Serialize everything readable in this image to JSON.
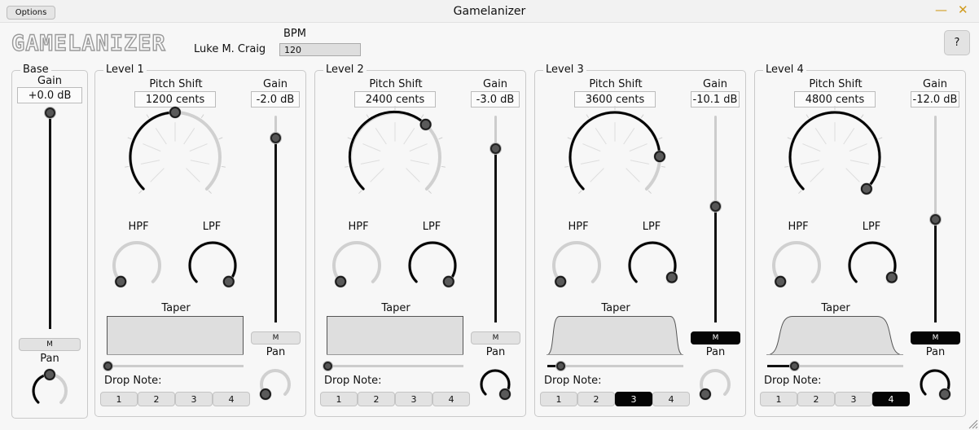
{
  "window": {
    "title": "Gamelanizer",
    "options_label": "Options",
    "minimize_glyph": "—",
    "close_glyph": "✕"
  },
  "header": {
    "logo": "GAMELANIZER",
    "author": "Luke M. Craig",
    "bpm_label": "BPM",
    "bpm_value": "120",
    "help_label": "?"
  },
  "base": {
    "title": "Base",
    "gain_label": "Gain",
    "gain_value": "+0.0 dB",
    "gain_level": 1.0,
    "mute_label": "M",
    "pan_label": "Pan",
    "pan_value": 0.5
  },
  "levels": [
    {
      "title": "Level 1",
      "pitch_label": "Pitch Shift",
      "pitch_value": "1200 cents",
      "pitch_knob": 0.5,
      "gain_label": "Gain",
      "gain_value": "-2.0 dB",
      "gain_level": 0.89,
      "hpf_label": "HPF",
      "hpf_knob": 0.0,
      "lpf_label": "LPF",
      "lpf_knob": 1.0,
      "taper_label": "Taper",
      "taper_slider": 0.0,
      "taper_shape": 0.0,
      "mute_label": "M",
      "mute_on": false,
      "pan_label": "Pan",
      "pan_knob": 0.0,
      "drop_label": "Drop Note:",
      "drop_notes": [
        "1",
        "2",
        "3",
        "4"
      ],
      "drop_active": -1
    },
    {
      "title": "Level 2",
      "pitch_label": "Pitch Shift",
      "pitch_value": "2400 cents",
      "pitch_knob": 0.66,
      "gain_label": "Gain",
      "gain_value": "-3.0 dB",
      "gain_level": 0.84,
      "hpf_label": "HPF",
      "hpf_knob": 0.0,
      "lpf_label": "LPF",
      "lpf_knob": 1.0,
      "taper_label": "Taper",
      "taper_slider": 0.0,
      "taper_shape": 0.0,
      "mute_label": "M",
      "mute_on": false,
      "pan_label": "Pan",
      "pan_knob": 1.0,
      "drop_label": "Drop Note:",
      "drop_notes": [
        "1",
        "2",
        "3",
        "4"
      ],
      "drop_active": -1
    },
    {
      "title": "Level 3",
      "pitch_label": "Pitch Shift",
      "pitch_value": "3600 cents",
      "pitch_knob": 0.83,
      "gain_label": "Gain",
      "gain_value": "-10.1 dB",
      "gain_level": 0.56,
      "hpf_label": "HPF",
      "hpf_knob": 0.0,
      "lpf_label": "LPF",
      "lpf_knob": 0.95,
      "taper_label": "Taper",
      "taper_slider": 0.1,
      "taper_shape": 0.1,
      "mute_label": "M",
      "mute_on": true,
      "pan_label": "Pan",
      "pan_knob": 0.0,
      "drop_label": "Drop Note:",
      "drop_notes": [
        "1",
        "2",
        "3",
        "4"
      ],
      "drop_active": 2
    },
    {
      "title": "Level 4",
      "pitch_label": "Pitch Shift",
      "pitch_value": "4800 cents",
      "pitch_knob": 1.0,
      "gain_label": "Gain",
      "gain_value": "-12.0 dB",
      "gain_level": 0.5,
      "hpf_label": "HPF",
      "hpf_knob": 0.0,
      "lpf_label": "LPF",
      "lpf_knob": 0.95,
      "taper_label": "Taper",
      "taper_slider": 0.2,
      "taper_shape": 0.2,
      "mute_label": "M",
      "mute_on": true,
      "pan_label": "Pan",
      "pan_knob": 1.0,
      "drop_label": "Drop Note:",
      "drop_notes": [
        "1",
        "2",
        "3",
        "4"
      ],
      "drop_active": 3
    }
  ],
  "colors": {
    "accent": "#000000",
    "track": "#cccccc",
    "panel_border": "#c9c9c9",
    "taper_fill": "#dedede"
  }
}
